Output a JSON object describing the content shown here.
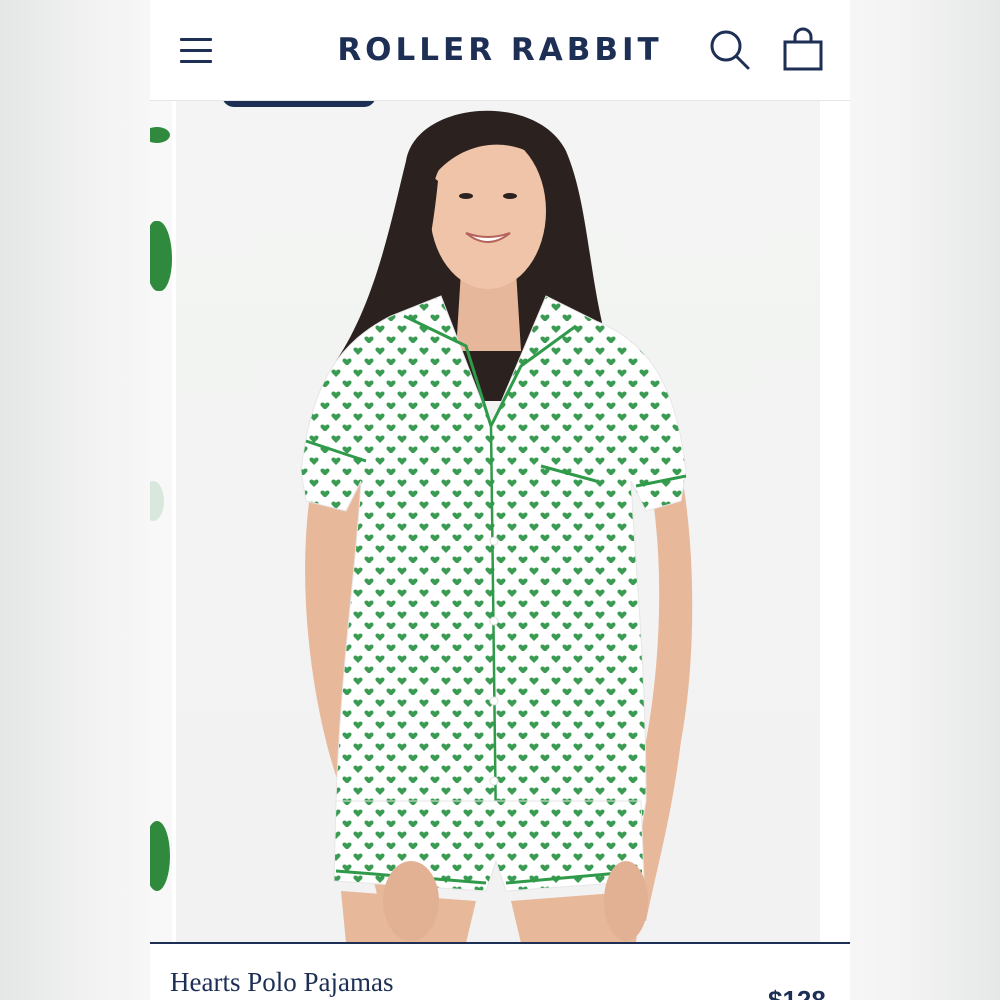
{
  "header": {
    "logo_text": "ROLLER RABBIT",
    "menu_icon": "hamburger-menu-icon",
    "search_icon": "search-icon",
    "bag_icon": "shopping-bag-icon"
  },
  "product": {
    "title": "Hearts Polo Pajamas",
    "price": "$128",
    "image_alt": "Model wearing white short-sleeve pajama set with green heart print and green piping"
  },
  "colors": {
    "brand_navy": "#1d2f55",
    "heart_green": "#2f9a49"
  }
}
